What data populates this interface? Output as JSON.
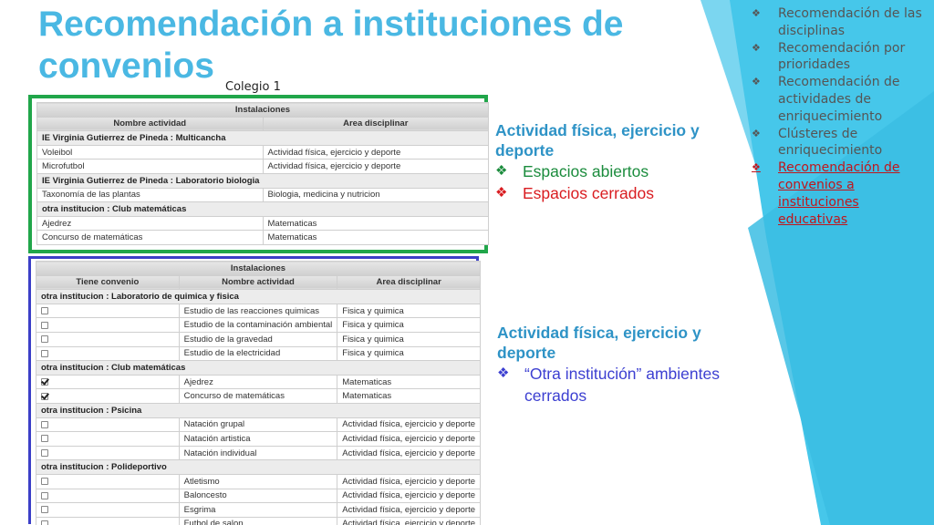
{
  "slide": {
    "title": "Recomendación a instituciones de convenios",
    "colegio_label": "Colegio 1",
    "colors": {
      "title": "#4ab8e3",
      "green_box": "#21a64a",
      "blue_box": "#3b3fc7",
      "panel": "#3fc2e6",
      "active": "#c0161c"
    }
  },
  "table1": {
    "header": "Instalaciones",
    "columns": [
      "Nombre actividad",
      "Area disciplinar"
    ],
    "rows": [
      {
        "group": "IE Virginia Gutierrez de Pineda : Multicancha"
      },
      {
        "cells": [
          "Voleibol",
          "Actividad física, ejercicio y deporte"
        ]
      },
      {
        "cells": [
          "Microfutbol",
          "Actividad física, ejercicio y deporte"
        ]
      },
      {
        "group": "IE Virginia Gutierrez de Pineda : Laboratorio biologia"
      },
      {
        "cells": [
          "Taxonomía de las plantas",
          "Biologia, medicina y nutricion"
        ]
      },
      {
        "group": "otra institucion : Club matemáticas"
      },
      {
        "cells": [
          "Ajedrez",
          "Matematicas"
        ]
      },
      {
        "cells": [
          "Concurso de matemáticas",
          "Matematicas"
        ]
      }
    ]
  },
  "table2": {
    "header": "Instalaciones",
    "columns": [
      "Tiene convenio",
      "Nombre actividad",
      "Area disciplinar"
    ],
    "rows": [
      {
        "group": "otra institucion : Laboratorio de quimica y fisica"
      },
      {
        "checked": false,
        "cells": [
          "Estudio de las reacciones quimicas",
          "Fisica y quimica"
        ]
      },
      {
        "checked": false,
        "cells": [
          "Estudio de la contaminación ambiental",
          "Fisica y quimica"
        ]
      },
      {
        "checked": false,
        "cells": [
          "Estudio de la gravedad",
          "Fisica y quimica"
        ]
      },
      {
        "checked": false,
        "cells": [
          "Estudio de la electricidad",
          "Fisica y quimica"
        ]
      },
      {
        "group": "otra institucion : Club matemáticas"
      },
      {
        "checked": true,
        "cells": [
          "Ajedrez",
          "Matematicas"
        ]
      },
      {
        "checked": true,
        "cells": [
          "Concurso de matemáticas",
          "Matematicas"
        ]
      },
      {
        "group": "otra institucion : Psicina"
      },
      {
        "checked": false,
        "cells": [
          "Natación grupal",
          "Actividad física, ejercicio y deporte"
        ]
      },
      {
        "checked": false,
        "cells": [
          "Natación artistica",
          "Actividad física, ejercicio y deporte"
        ]
      },
      {
        "checked": false,
        "cells": [
          "Natación individual",
          "Actividad física, ejercicio y deporte"
        ]
      },
      {
        "group": "otra institucion : Polideportivo"
      },
      {
        "checked": false,
        "cells": [
          "Atletismo",
          "Actividad física, ejercicio y deporte"
        ]
      },
      {
        "checked": false,
        "cells": [
          "Baloncesto",
          "Actividad física, ejercicio y deporte"
        ]
      },
      {
        "checked": false,
        "cells": [
          "Esgrima",
          "Actividad física, ejercicio y deporte"
        ]
      },
      {
        "checked": false,
        "cells": [
          "Futbol de salon",
          "Actividad física, ejercicio y deporte"
        ]
      }
    ]
  },
  "note1": {
    "heading": "Actividad física, ejercicio y deporte",
    "items": [
      {
        "bullet": "❖",
        "text": "Espacios abiertos",
        "color": "green"
      },
      {
        "bullet": "❖",
        "text": "Espacios cerrados",
        "color": "red"
      }
    ]
  },
  "note2": {
    "heading": "Actividad física, ejercicio y deporte",
    "items": [
      {
        "bullet": "❖",
        "text": "“Otra institución” ambientes cerrados",
        "color": "blue"
      }
    ]
  },
  "sidebar": {
    "items": [
      {
        "bullet": "❖",
        "text": "Recomendación de las disciplinas",
        "active": false
      },
      {
        "bullet": "❖",
        "text": "Recomendación por prioridades",
        "active": false
      },
      {
        "bullet": "❖",
        "text": "Recomendación de actividades de enriquecimiento",
        "active": false
      },
      {
        "bullet": "❖",
        "text": "Clústeres de enriquecimiento",
        "active": false
      },
      {
        "bullet": "❖",
        "text": "Recomendación de convenios a instituciones educativas",
        "active": true
      }
    ]
  }
}
